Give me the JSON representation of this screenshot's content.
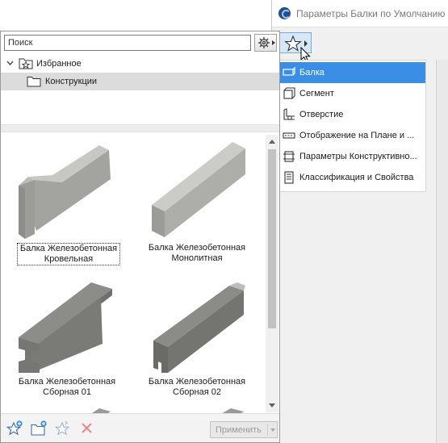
{
  "dialog": {
    "title": "Параметры Балки по Умолчанию",
    "menu": {
      "items": [
        {
          "label": "Балка",
          "icon": "beam-icon",
          "selected": true
        },
        {
          "label": "Сегмент",
          "icon": "segment-icon",
          "selected": false
        },
        {
          "label": "Отверстие",
          "icon": "hole-icon",
          "selected": false
        },
        {
          "label": "Отображение на Плане и ...",
          "icon": "floor-plan-icon",
          "selected": false
        },
        {
          "label": "Параметры Конструктивно...",
          "icon": "structural-icon",
          "selected": false
        },
        {
          "label": "Классификация и Свойства",
          "icon": "properties-icon",
          "selected": false
        }
      ]
    }
  },
  "panel": {
    "search": {
      "placeholder": "Поиск"
    },
    "tree": {
      "root": {
        "label": "Избранное",
        "expanded": true
      },
      "folder": {
        "label": "Конструкции",
        "selected": true
      }
    },
    "items": [
      {
        "line1": "Балка Железобетонная",
        "line2": "Кровельная",
        "selected": true
      },
      {
        "line1": "Балка Железобетонная",
        "line2": "Монолитная",
        "selected": false
      },
      {
        "line1": "Балка Железобетонная",
        "line2": "Сборная 01",
        "selected": false
      },
      {
        "line1": "Балка Железобетонная",
        "line2": "Сборная 02",
        "selected": false
      }
    ],
    "footer": {
      "apply_label": "Применить",
      "buttons": [
        "add-favorite-icon",
        "new-folder-icon",
        "redefine-favorite-icon",
        "delete-icon"
      ]
    }
  },
  "colors": {
    "selection": "#3a8ee6",
    "tree_selection": "#dcdcdc",
    "concrete": "#a9a9a6",
    "delete": "#e06060"
  }
}
